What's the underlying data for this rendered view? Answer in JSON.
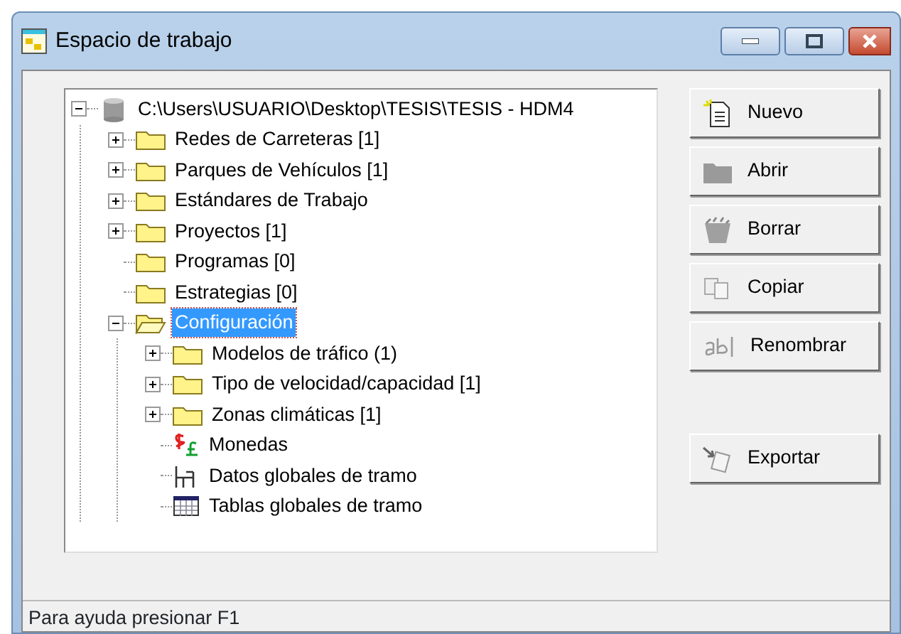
{
  "window": {
    "title": "Espacio de trabajo"
  },
  "tree": [
    {
      "label": "C:\\Users\\USUARIO\\Desktop\\TESIS\\TESIS - HDM4",
      "kind": "database",
      "expanded": true,
      "selected": false,
      "children": [
        {
          "label": "Redes de Carreteras [1]",
          "kind": "folder",
          "expanded": false,
          "selected": false
        },
        {
          "label": "Parques de Vehículos [1]",
          "kind": "folder",
          "expanded": false,
          "selected": false
        },
        {
          "label": "Estándares de Trabajo",
          "kind": "folder",
          "expanded": false,
          "selected": false
        },
        {
          "label": "Proyectos [1]",
          "kind": "folder",
          "expanded": false,
          "selected": false
        },
        {
          "label": "Programas [0]",
          "kind": "folder",
          "selected": false
        },
        {
          "label": "Estrategias [0]",
          "kind": "folder",
          "selected": false
        },
        {
          "label": "Configuración",
          "kind": "folder",
          "expanded": true,
          "selected": true,
          "children": [
            {
              "label": "Modelos de tráfico (1)",
              "kind": "folder",
              "expanded": false,
              "selected": false
            },
            {
              "label": "Tipo de velocidad/capacidad [1]",
              "kind": "folder",
              "expanded": false,
              "selected": false
            },
            {
              "label": "Zonas climáticas [1]",
              "kind": "folder",
              "expanded": false,
              "selected": false
            },
            {
              "label": "Monedas",
              "kind": "currency",
              "selected": false
            },
            {
              "label": "Datos globales de tramo",
              "kind": "data",
              "selected": false
            },
            {
              "label": "Tablas globales de tramo",
              "kind": "table",
              "selected": false
            }
          ]
        }
      ]
    }
  ],
  "button_groups": [
    [
      {
        "label": "Nuevo",
        "kind": "new"
      },
      {
        "label": "Abrir",
        "kind": "open"
      },
      {
        "label": "Borrar",
        "kind": "delete"
      },
      {
        "label": "Copiar",
        "kind": "copy"
      },
      {
        "label": "Renombrar",
        "kind": "rename"
      }
    ],
    [
      {
        "label": "Exportar",
        "kind": "export"
      }
    ]
  ],
  "status_bar": "Para ayuda presionar F1"
}
